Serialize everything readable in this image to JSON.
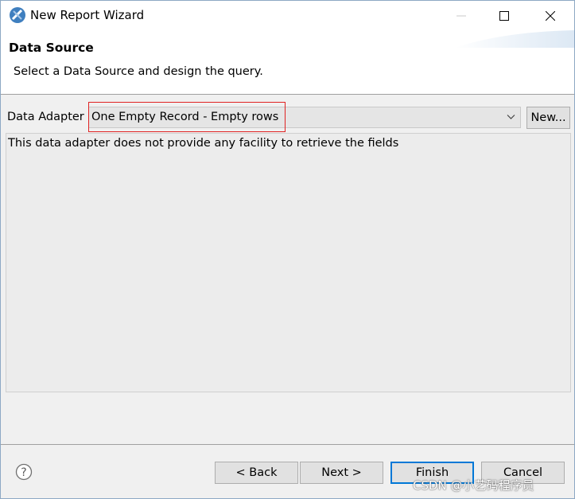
{
  "window": {
    "title": "New Report Wizard"
  },
  "header": {
    "title": "Data Source",
    "description": "Select a Data Source and design the query."
  },
  "adapter": {
    "label": "Data Adapter",
    "selected_value": "One Empty Record - Empty rows",
    "new_button_label": "New..."
  },
  "info": {
    "message": "This data adapter does not provide any facility to retrieve the fields"
  },
  "footer": {
    "back_label": "< Back",
    "next_label": "Next >",
    "finish_label": "Finish",
    "cancel_label": "Cancel"
  },
  "watermark": {
    "text": "CSDN @小艺码程序员"
  },
  "colors": {
    "highlight_border": "#e02222",
    "default_button_border": "#0078d7"
  }
}
